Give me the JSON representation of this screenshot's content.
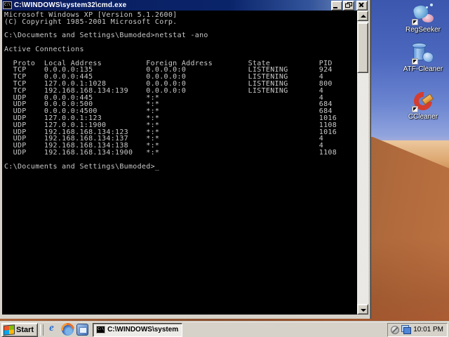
{
  "window": {
    "title": "C:\\WINDOWS\\system32\\cmd.exe",
    "icon_text": "C:\\"
  },
  "console": {
    "lines": [
      "Microsoft Windows XP [Version 5.1.2600]",
      "(C) Copyright 1985-2001 Microsoft Corp.",
      "",
      "C:\\Documents and Settings\\Bumoded>netstat -ano",
      "",
      "Active Connections",
      "",
      "  Proto  Local Address          Foreign Address        State           PID",
      "  TCP    0.0.0.0:135            0.0.0.0:0              LISTENING       924",
      "  TCP    0.0.0.0:445            0.0.0.0:0              LISTENING       4",
      "  TCP    127.0.0.1:1028         0.0.0.0:0              LISTENING       800",
      "  TCP    192.168.168.134:139    0.0.0.0:0              LISTENING       4",
      "  UDP    0.0.0.0:445            *:*                                    4",
      "  UDP    0.0.0.0:500            *:*                                    684",
      "  UDP    0.0.0.0:4500           *:*                                    684",
      "  UDP    127.0.0.1:123          *:*                                    1016",
      "  UDP    127.0.0.1:1900         *:*                                    1108",
      "  UDP    192.168.168.134:123    *:*                                    1016",
      "  UDP    192.168.168.134:137    *:*                                    4",
      "  UDP    192.168.168.134:138    *:*                                    4",
      "  UDP    192.168.168.134:1900   *:*                                    1108",
      "",
      "C:\\Documents and Settings\\Bumoded>_"
    ]
  },
  "desktop": {
    "icons": [
      {
        "name": "regseeker",
        "label": "RegSeeker"
      },
      {
        "name": "atf-cleaner",
        "label": "ATF-Cleaner"
      },
      {
        "name": "ccleaner",
        "label": "CCleaner"
      }
    ]
  },
  "taskbar": {
    "start_label": "Start",
    "quick_launch": [
      {
        "name": "internet-explorer-icon"
      },
      {
        "name": "firefox-icon"
      },
      {
        "name": "blue-window-icon"
      }
    ],
    "task_button_label": "C:\\WINDOWS\\system...",
    "tray": {
      "time": "10:01 PM"
    }
  },
  "colors": {
    "titlebar_left": "#0a1c5e",
    "titlebar_right": "#8399c6",
    "console_bg": "#000000",
    "console_text": "#c9c9c9",
    "chrome_gray": "#d6d2ca",
    "sky_top": "#3b57ae",
    "dune_lit": "#c9854d",
    "dune_shadow": "#8a5c3a"
  }
}
